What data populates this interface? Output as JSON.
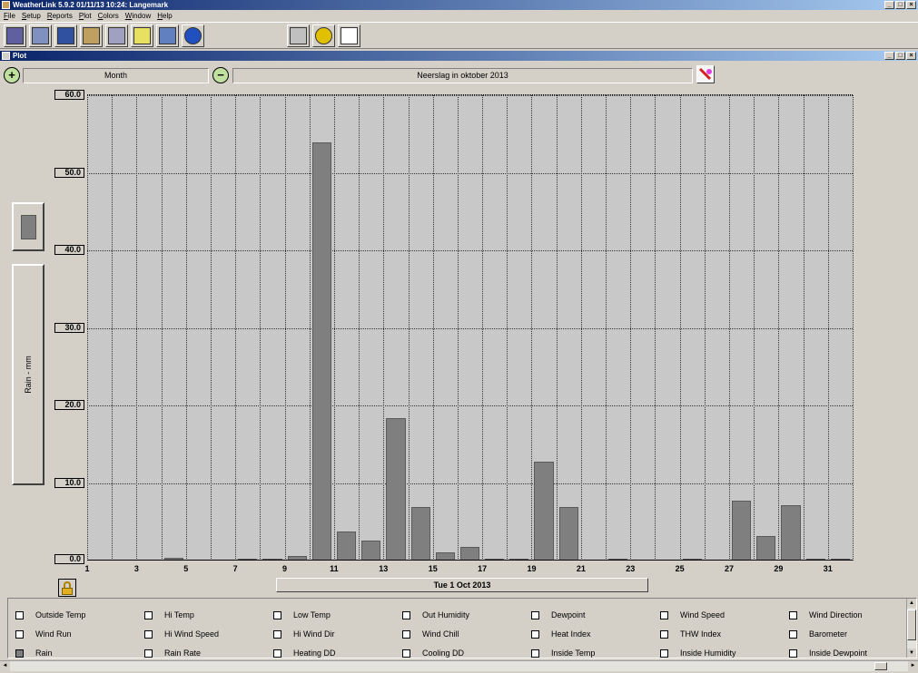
{
  "app": {
    "title": "WeatherLink 5.9.2  01/11/13  10:24: Langemark",
    "window_buttons": [
      "_",
      "□",
      "×"
    ]
  },
  "menu": [
    "File",
    "Setup",
    "Reports",
    "Plot",
    "Colors",
    "Window",
    "Help"
  ],
  "toolbar": {
    "buttons": [
      {
        "icon": "station-icon",
        "color": "#6060a0"
      },
      {
        "icon": "download-icon",
        "color": "#8090c0"
      },
      {
        "icon": "bulletin-icon",
        "color": "#3050a0"
      },
      {
        "icon": "plot-icon",
        "color": "#c0a060"
      },
      {
        "icon": "summary-icon",
        "color": "#a0a0c0"
      },
      {
        "icon": "notes-icon",
        "color": "#e8e060"
      },
      {
        "icon": "weather-icon",
        "color": "#6080c0"
      },
      {
        "icon": "noaa-icon",
        "color": "#2050c0"
      },
      {
        "icon": "print-icon",
        "color": "#c0c0c0"
      },
      {
        "icon": "help-icon",
        "color": "#e0c000"
      },
      {
        "icon": "close-icon",
        "color": "#ffffff"
      }
    ]
  },
  "plot_window": {
    "title": "Plot",
    "zoom_in": "+",
    "zoom_out": "−",
    "period": "Month",
    "chart_title": "Neerslag in oktober 2013",
    "unit_label": "Rain - mm",
    "date_label": "Tue 1 Oct 2013"
  },
  "chart_data": {
    "type": "bar",
    "title": "Neerslag in oktober 2013",
    "ylabel": "Rain - mm",
    "xlabel": "Tue 1 Oct 2013",
    "ylim": [
      0,
      60
    ],
    "yticks": [
      "0.0",
      "10.0",
      "20.0",
      "30.0",
      "40.0",
      "50.0",
      "60.0"
    ],
    "xticks": [
      "1",
      "3",
      "5",
      "7",
      "9",
      "11",
      "13",
      "15",
      "17",
      "19",
      "21",
      "23",
      "25",
      "27",
      "29",
      "31"
    ],
    "grid": true,
    "bar_color": "#7f7f7f",
    "categories": [
      1,
      2,
      3,
      4,
      5,
      6,
      7,
      8,
      9,
      10,
      11,
      12,
      13,
      14,
      15,
      16,
      17,
      18,
      19,
      20,
      21,
      22,
      23,
      24,
      25,
      26,
      27,
      28,
      29,
      30,
      31
    ],
    "values": [
      0,
      0,
      0,
      0.3,
      0,
      0,
      0.1,
      0.2,
      0.6,
      53.9,
      3.8,
      2.6,
      18.4,
      6.9,
      1.1,
      1.8,
      0.2,
      0.2,
      12.8,
      6.9,
      0,
      0.1,
      0,
      0,
      0.1,
      0,
      7.7,
      3.1,
      7.1,
      0.2,
      0.2
    ]
  },
  "legend": {
    "items": [
      [
        "Outside Temp",
        "Hi Temp",
        "Low Temp",
        "Out Humidity",
        "Dewpoint",
        "Wind Speed",
        "Wind Direction"
      ],
      [
        "Wind Run",
        "Hi Wind Speed",
        "Hi Wind Dir",
        "Wind Chill",
        "Heat Index",
        "THW Index",
        "Barometer"
      ],
      [
        "Rain",
        "Rain Rate",
        "Heating DD",
        "Cooling DD",
        "Inside Temp",
        "Inside Humidity",
        "Inside Dewpoint"
      ]
    ],
    "checked": [
      "Rain"
    ]
  }
}
